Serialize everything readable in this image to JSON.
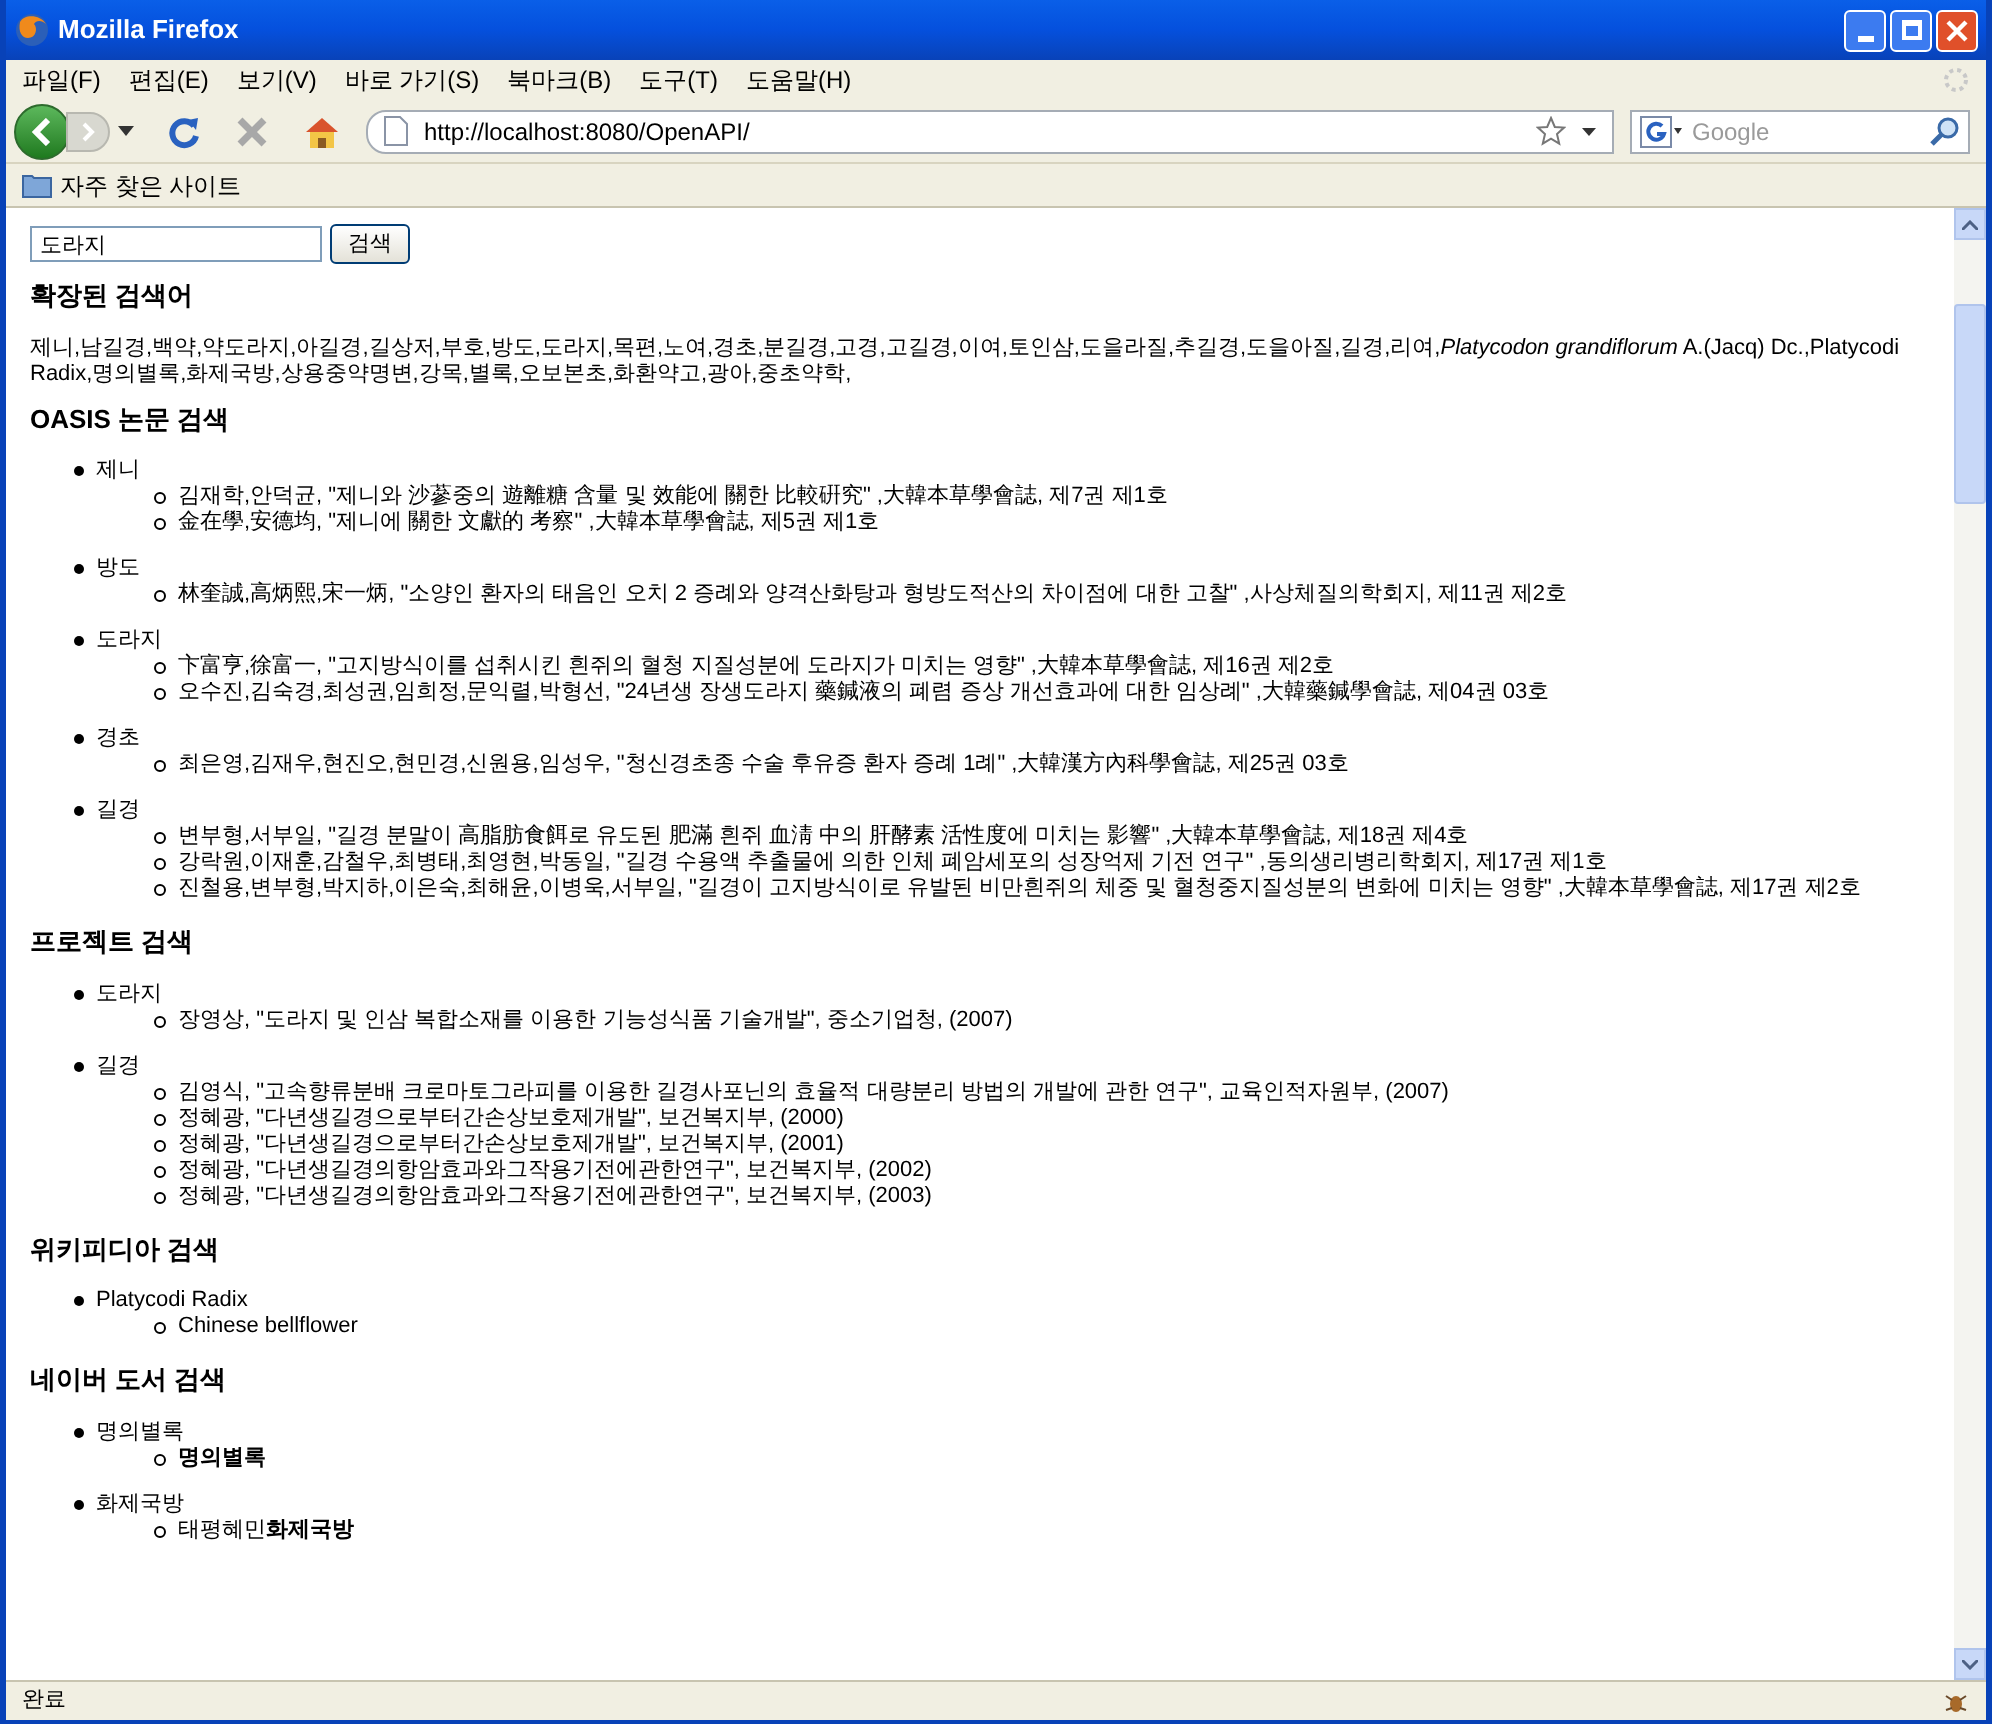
{
  "window": {
    "title": "Mozilla Firefox"
  },
  "menu": [
    "파일(F)",
    "편집(E)",
    "보기(V)",
    "바로 가기(S)",
    "북마크(B)",
    "도구(T)",
    "도움말(H)"
  ],
  "toolbar": {
    "url": "http://localhost:8080/OpenAPI/",
    "search_placeholder": "Google"
  },
  "bookmarks": [
    "자주 찾은 사이트"
  ],
  "page": {
    "query": "도라지",
    "search_button": "검색",
    "sections": [
      {
        "title": "확장된 검색어",
        "kind": "text",
        "text": "제니,남길경,백약,약도라지,아길경,길상저,부호,방도,도라지,목편,노여,경초,분길경,고경,고길경,이여,토인삼,도을라질,추길경,도을아질,길경,리여,*Platycodon grandiflorum* A.(Jacq) Dc.,Platycodi Radix,명의별록,화제국방,상용중약명변,강목,별록,오보본초,화환약고,광아,중초약학,"
      },
      {
        "title": "OASIS 논문 검색",
        "kind": "list",
        "groups": [
          {
            "label": "제니",
            "items": [
              "김재학,안덕균, \"제니와 沙蔘중의 遊離糖 含量 및 效能에 關한 比較硏究\" ,大韓本草學會誌, 제7권 제1호",
              "金在學,安德均, \"제니에 關한 文獻的 考察\" ,大韓本草學會誌, 제5권 제1호"
            ]
          },
          {
            "label": "방도",
            "items": [
              "林奎誠,高炳熙,宋一炳, \"소양인 환자의 태음인 오치 2 증례와 양격산화탕과 형방도적산의 차이점에 대한 고찰\" ,사상체질의학회지, 제11권 제2호"
            ]
          },
          {
            "label": "도라지",
            "items": [
              "卞富亨,徐富一, \"고지방식이를 섭취시킨 흰쥐의 혈청 지질성분에 도라지가 미치는 영향\" ,大韓本草學會誌, 제16권 제2호",
              "오수진,김숙경,최성권,임희정,문익렬,박형선, \"24년생 장생도라지 藥鍼液의 폐렴 증상 개선효과에 대한 임상례\" ,大韓藥鍼學會誌, 제04권 03호"
            ]
          },
          {
            "label": "경초",
            "items": [
              "최은영,김재우,현진오,현민경,신원용,임성우, \"청신경초종 수술 후유증 환자 증례 1례\" ,大韓漢方內科學會誌, 제25권 03호"
            ]
          },
          {
            "label": "길경",
            "items": [
              "변부형,서부일, \"길경 분말이 高脂肪食餌로 유도된 肥滿 흰쥐 血淸 中의 肝酵素 活性度에 미치는 影響\" ,大韓本草學會誌, 제18권 제4호",
              "강락원,이재훈,감철우,최병태,최영현,박동일, \"길경 수용액 추출물에 의한 인체 폐암세포의 성장억제 기전 연구\" ,동의생리병리학회지, 제17권 제1호",
              "진철용,변부형,박지하,이은숙,최해윤,이병욱,서부일, \"길경이 고지방식이로 유발된 비만흰쥐의 체중 및 혈청중지질성분의 변화에 미치는 영향\" ,大韓本草學會誌, 제17권 제2호"
            ]
          }
        ]
      },
      {
        "title": "프로젝트 검색",
        "kind": "list",
        "groups": [
          {
            "label": "도라지",
            "items": [
              "장영상, \"도라지 및 인삼 복합소재를 이용한 기능성식품 기술개발\", 중소기업청, (2007)"
            ]
          },
          {
            "label": "길경",
            "items": [
              "김영식, \"고속향류분배 크로마토그라피를 이용한 길경사포닌의 효율적 대량분리 방법의 개발에 관한 연구\", 교육인적자원부, (2007)",
              "정혜광, \"다년생길경으로부터간손상보호제개발\", 보건복지부, (2000)",
              "정혜광, \"다년생길경으로부터간손상보호제개발\", 보건복지부, (2001)",
              "정혜광, \"다년생길경의항암효과와그작용기전에관한연구\", 보건복지부, (2002)",
              "정혜광, \"다년생길경의항암효과와그작용기전에관한연구\", 보건복지부, (2003)"
            ]
          }
        ]
      },
      {
        "title": "위키피디아 검색",
        "kind": "list",
        "groups": [
          {
            "label": "Platycodi Radix",
            "items": [
              "Chinese bellflower"
            ]
          }
        ]
      },
      {
        "title": "네이버 도서 검색",
        "kind": "list",
        "groups": [
          {
            "label": "명의별록",
            "items": [
              "**명의별록**"
            ]
          },
          {
            "label": "화제국방",
            "items": [
              "태평혜민**화제국방**"
            ]
          }
        ]
      }
    ]
  },
  "status": "완료"
}
